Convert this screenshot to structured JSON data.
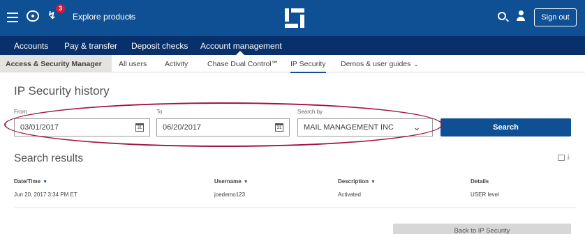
{
  "topbar": {
    "explore_label": "Explore products",
    "notification_count": "3",
    "signout_label": "Sign out",
    "bg_color": "#0f4f93"
  },
  "nav1": {
    "items": [
      "Accounts",
      "Pay & transfer",
      "Deposit checks",
      "Account management"
    ],
    "active_index": 3,
    "bg_color": "#08306a"
  },
  "nav2": {
    "items": [
      "Access & Security Manager",
      "All users",
      "Activity",
      "Chase Dual Control℠",
      "IP Security",
      "Demos & user guides"
    ],
    "active_index": 0,
    "selected_index": 4
  },
  "page": {
    "title": "IP Security history"
  },
  "filters": {
    "from_label": "From",
    "from_value": "03/01/2017",
    "to_label": "To",
    "to_value": "06/20/2017",
    "search_by_label": "Search by",
    "search_by_value": "MAIL MANAGEMENT INC",
    "search_button": "Search",
    "calendar_glyph": "31"
  },
  "results": {
    "title": "Search results",
    "columns": [
      "Date/Time",
      "Username",
      "Description",
      "Details"
    ],
    "rows": [
      [
        "Jun 20, 2017 3:34 PM ET",
        "joedemo123",
        "Activated",
        "USER level"
      ]
    ]
  },
  "footer": {
    "back_button": "Back to IP Security"
  },
  "accent": {
    "annotation_color": "#a01548",
    "primary_button": "#0f4f93"
  }
}
